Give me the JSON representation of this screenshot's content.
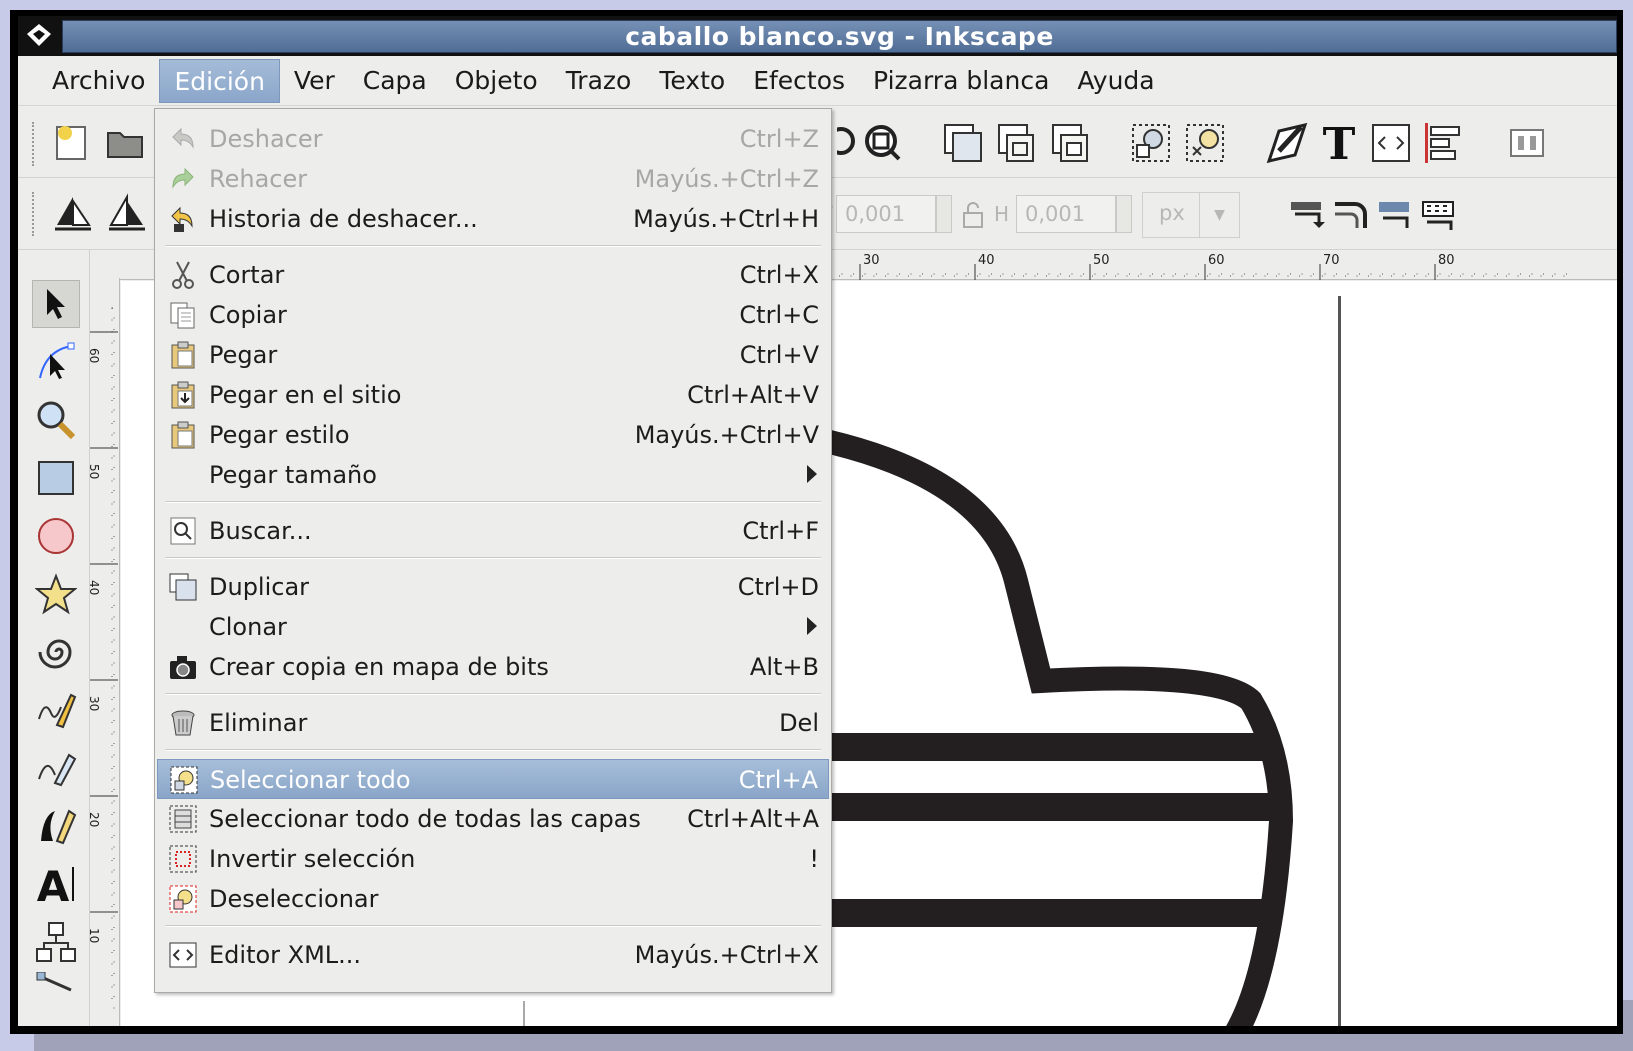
{
  "window": {
    "title": "caballo blanco.svg - Inkscape"
  },
  "menubar": {
    "items": [
      "Archivo",
      "Edición",
      "Ver",
      "Capa",
      "Objeto",
      "Trazo",
      "Texto",
      "Efectos",
      "Pizarra blanca",
      "Ayuda"
    ],
    "active": "Edición"
  },
  "toolbar2": {
    "w_value": "0,001",
    "h_label": "H",
    "h_value": "0,001",
    "unit": "px"
  },
  "ruler": {
    "h_ticks": [
      "30",
      "40",
      "50",
      "60",
      "70",
      "80"
    ],
    "v_ticks": [
      "60",
      "50",
      "40",
      "30",
      "20",
      "10"
    ]
  },
  "edit_menu": {
    "items": [
      {
        "label": "Deshacer",
        "shortcut": "Ctrl+Z",
        "icon": "undo-icon",
        "disabled": true
      },
      {
        "label": "Rehacer",
        "shortcut": "Mayús.+Ctrl+Z",
        "icon": "redo-icon",
        "disabled": true
      },
      {
        "label": "Historia de deshacer...",
        "shortcut": "Mayús.+Ctrl+H",
        "icon": "undo-history-icon"
      },
      {
        "label": "Cortar",
        "shortcut": "Ctrl+X",
        "icon": "scissors-icon"
      },
      {
        "label": "Copiar",
        "shortcut": "Ctrl+C",
        "icon": "copy-icon"
      },
      {
        "label": "Pegar",
        "shortcut": "Ctrl+V",
        "icon": "paste-icon"
      },
      {
        "label": "Pegar en el sitio",
        "shortcut": "Ctrl+Alt+V",
        "icon": "paste-in-place-icon"
      },
      {
        "label": "Pegar estilo",
        "shortcut": "Mayús.+Ctrl+V",
        "icon": "paste-style-icon"
      },
      {
        "label": "Pegar tamaño",
        "shortcut": "",
        "icon": "",
        "submenu": true
      },
      {
        "label": "Buscar...",
        "shortcut": "Ctrl+F",
        "icon": "find-icon"
      },
      {
        "label": "Duplicar",
        "shortcut": "Ctrl+D",
        "icon": "duplicate-icon"
      },
      {
        "label": "Clonar",
        "shortcut": "",
        "icon": "",
        "submenu": true
      },
      {
        "label": "Crear copia en mapa de bits",
        "shortcut": "Alt+B",
        "icon": "camera-icon"
      },
      {
        "label": "Eliminar",
        "shortcut": "Del",
        "icon": "trash-icon"
      },
      {
        "label": "Seleccionar todo",
        "shortcut": "Ctrl+A",
        "icon": "select-all-icon",
        "highlight": true
      },
      {
        "label": "Seleccionar todo de todas las capas",
        "shortcut": "Ctrl+Alt+A",
        "icon": "select-all-layers-icon"
      },
      {
        "label": "Invertir selección",
        "shortcut": "!",
        "icon": "invert-selection-icon"
      },
      {
        "label": "Deseleccionar",
        "shortcut": "",
        "icon": "deselect-icon"
      },
      {
        "label": "Editor XML...",
        "shortcut": "Mayús.+Ctrl+X",
        "icon": "xml-editor-icon"
      }
    ]
  },
  "colors": {
    "highlight": "#8aa6ca",
    "titlebar": "#5f7ca3",
    "drawing_stroke": "#231f20"
  }
}
